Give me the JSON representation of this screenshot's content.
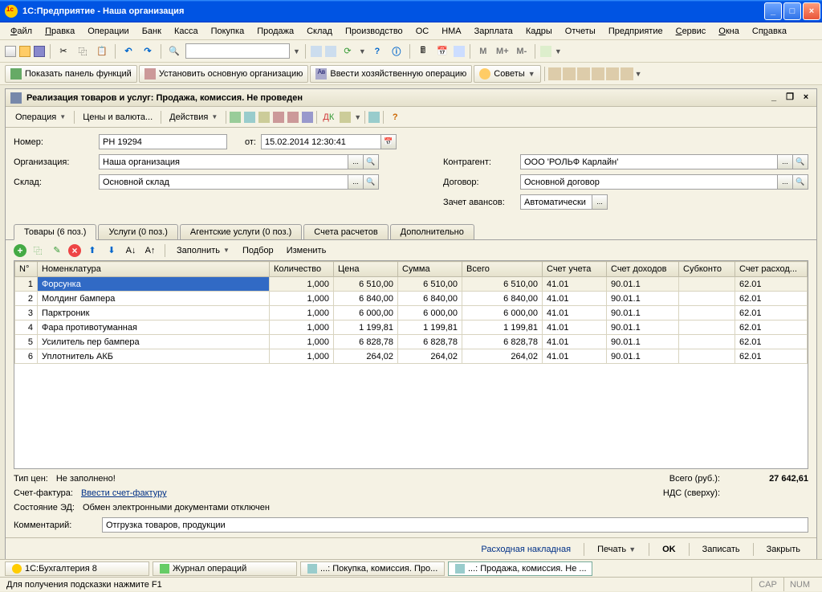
{
  "app": {
    "title": "1С:Предприятие  - Наша организация"
  },
  "menu": {
    "items": [
      "Файл",
      "Правка",
      "Операции",
      "Банк",
      "Касса",
      "Покупка",
      "Продажа",
      "Склад",
      "Производство",
      "ОС",
      "НМА",
      "Зарплата",
      "Кадры",
      "Отчеты",
      "Предприятие",
      "Сервис",
      "Окна",
      "Справка"
    ]
  },
  "toolbar2": {
    "btn1": "Показать панель функций",
    "btn2": "Установить основную организацию",
    "btn3": "Ввести хозяйственную операцию",
    "btn4": "Советы"
  },
  "doc": {
    "title": "Реализация товаров и услуг: Продажа, комиссия. Не проведен",
    "tb": {
      "operation": "Операция",
      "prices": "Цены и валюта...",
      "actions": "Действия"
    },
    "form": {
      "number_label": "Номер:",
      "number": "РН 19294",
      "date_label": "от:",
      "date": "15.02.2014 12:30:41",
      "org_label": "Организация:",
      "org": "Наша организация",
      "sklad_label": "Склад:",
      "sklad": "Основной склад",
      "contr_label": "Контрагент:",
      "contr": "ООО 'РОЛЬФ Карлайн'",
      "dogovor_label": "Договор:",
      "dogovor": "Основной договор",
      "avans_label": "Зачет авансов:",
      "avans": "Автоматически"
    },
    "tabs": {
      "t1": "Товары (6 поз.)",
      "t2": "Услуги (0 поз.)",
      "t3": "Агентские услуги (0 поз.)",
      "t4": "Счета расчетов",
      "t5": "Дополнительно"
    },
    "tabtb": {
      "fill": "Заполнить",
      "pick": "Подбор",
      "edit": "Изменить"
    },
    "gridcols": [
      "N°",
      "Номенклатура",
      "Количество",
      "Цена",
      "Сумма",
      "Всего",
      "Счет учета",
      "Счет доходов",
      "Субконто",
      "Счет расход..."
    ],
    "rows": [
      {
        "n": "1",
        "name": "Форсунка",
        "qty": "1,000",
        "price": "6 510,00",
        "sum": "6 510,00",
        "total": "6 510,00",
        "acc": "41.01",
        "inc": "90.01.1",
        "sub": "",
        "exp": "62.01"
      },
      {
        "n": "2",
        "name": "Молдинг бампера",
        "qty": "1,000",
        "price": "6 840,00",
        "sum": "6 840,00",
        "total": "6 840,00",
        "acc": "41.01",
        "inc": "90.01.1",
        "sub": "",
        "exp": "62.01"
      },
      {
        "n": "3",
        "name": "Парктроник",
        "qty": "1,000",
        "price": "6 000,00",
        "sum": "6 000,00",
        "total": "6 000,00",
        "acc": "41.01",
        "inc": "90.01.1",
        "sub": "",
        "exp": "62.01"
      },
      {
        "n": "4",
        "name": "Фара противотуманная",
        "qty": "1,000",
        "price": "1 199,81",
        "sum": "1 199,81",
        "total": "1 199,81",
        "acc": "41.01",
        "inc": "90.01.1",
        "sub": "",
        "exp": "62.01"
      },
      {
        "n": "5",
        "name": "Усилитель пер бампера",
        "qty": "1,000",
        "price": "6 828,78",
        "sum": "6 828,78",
        "total": "6 828,78",
        "acc": "41.01",
        "inc": "90.01.1",
        "sub": "",
        "exp": "62.01"
      },
      {
        "n": "6",
        "name": "Уплотнитель АКБ",
        "qty": "1,000",
        "price": "264,02",
        "sum": "264,02",
        "total": "264,02",
        "acc": "41.01",
        "inc": "90.01.1",
        "sub": "",
        "exp": "62.01"
      }
    ],
    "footer": {
      "pricetype_label": "Тип цен:",
      "pricetype": "Не заполнено!",
      "total_label": "Всего (руб.):",
      "total": "27 642,61",
      "sf_label": "Счет-фактура:",
      "sf_link": "Ввести счет-фактуру",
      "nds_label": "НДС (сверху):",
      "nds": "",
      "ed_label": "Состояние ЭД:",
      "ed": "Обмен электронными документами отключен",
      "comment_label": "Комментарий:",
      "comment": "Отгрузка товаров, продукции"
    },
    "buttons": {
      "naklad": "Расходная накладная",
      "print": "Печать",
      "ok": "OK",
      "write": "Записать",
      "close": "Закрыть"
    }
  },
  "tasks": {
    "t1": "1С:Бухгалтерия 8",
    "t2": "Журнал операций",
    "t3": "...: Покупка, комиссия. Про...",
    "t4": "...: Продажа, комиссия. Не ..."
  },
  "status": {
    "hint": "Для получения подсказки нажмите F1",
    "cap": "CAP",
    "num": "NUM"
  }
}
